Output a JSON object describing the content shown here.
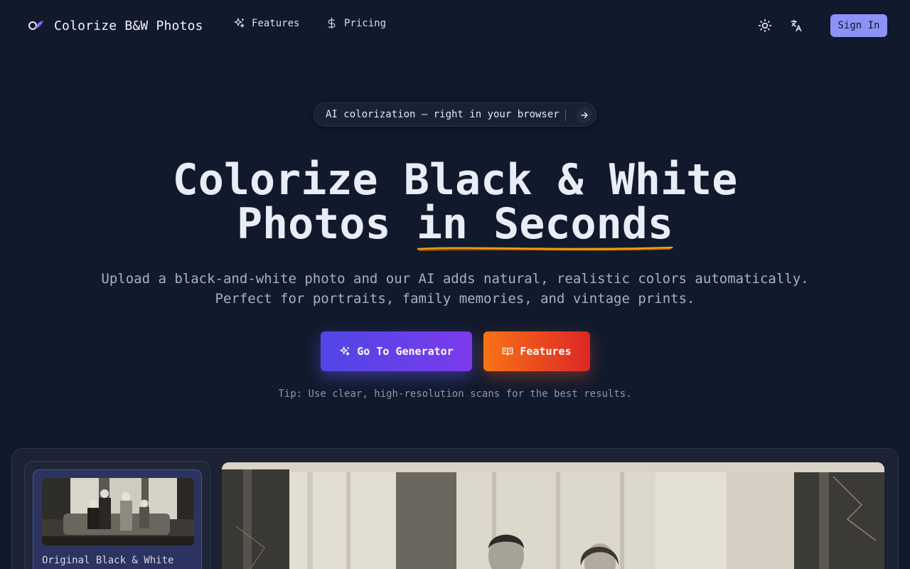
{
  "brand": {
    "name": "Colorize B&W Photos",
    "logo_icon": "logo-icon"
  },
  "nav": {
    "links": [
      {
        "label": "Features",
        "icon": "sparkles-icon"
      },
      {
        "label": "Pricing",
        "icon": "dollar-icon"
      }
    ],
    "theme_icon": "sun-icon",
    "language_icon": "translate-icon",
    "signin_label": "Sign In"
  },
  "hero": {
    "pill_text": "AI colorization — right in your browser",
    "headline_line1": "Colorize Black & White",
    "headline_line2_plain": "Photos ",
    "headline_line2_accent": "in Seconds",
    "subtext_line1": "Upload a black-and-white photo and our AI adds natural, realistic colors automatically.",
    "subtext_line2": "Perfect for portraits, family memories, and vintage prints.",
    "primary_button": "Go To Generator",
    "secondary_button": "Features",
    "tip": "Tip: Use clear, high-resolution scans for the best results."
  },
  "demo": {
    "thumbnails": [
      {
        "label": "Original Black & White Photo"
      }
    ]
  },
  "colors": {
    "background": "#111a2c",
    "signin": "#8b93f8",
    "primary_gradient": [
      "#4f46e5",
      "#7c3aed"
    ],
    "secondary_gradient": [
      "#f97316",
      "#dc2626"
    ],
    "underline": "#f59e0b"
  }
}
